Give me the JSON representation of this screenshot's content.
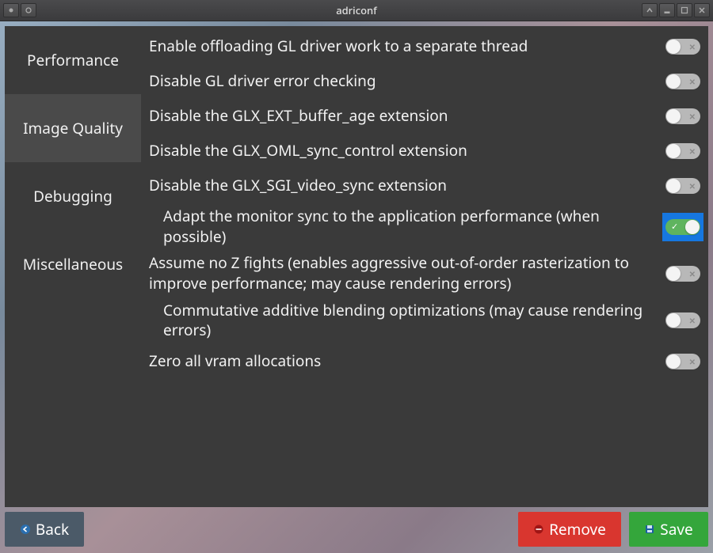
{
  "window": {
    "title": "adriconf"
  },
  "sidebar": {
    "items": [
      {
        "label": "Performance",
        "selected": false
      },
      {
        "label": "Image Quality",
        "selected": true
      },
      {
        "label": "Debugging",
        "selected": false
      },
      {
        "label": "Miscellaneous",
        "selected": false
      }
    ]
  },
  "options": [
    {
      "label": "Enable offloading GL driver work to a separate thread",
      "on": false,
      "indent": false,
      "highlight": false
    },
    {
      "label": "Disable GL driver error checking",
      "on": false,
      "indent": false,
      "highlight": false
    },
    {
      "label": "Disable the GLX_EXT_buffer_age extension",
      "on": false,
      "indent": false,
      "highlight": false
    },
    {
      "label": "Disable the GLX_OML_sync_control extension",
      "on": false,
      "indent": false,
      "highlight": false
    },
    {
      "label": "Disable the GLX_SGI_video_sync extension",
      "on": false,
      "indent": false,
      "highlight": false
    },
    {
      "label": "Adapt the monitor sync to the application performance (when possible)",
      "on": true,
      "indent": true,
      "highlight": true
    },
    {
      "label": "Assume no Z fights (enables aggressive out-of-order rasterization to improve performance; may cause rendering errors)",
      "on": false,
      "indent": false,
      "highlight": false
    },
    {
      "label": "Commutative additive blending optimizations (may cause rendering errors)",
      "on": false,
      "indent": true,
      "highlight": false
    },
    {
      "label": "Zero all vram allocations",
      "on": false,
      "indent": false,
      "highlight": false
    }
  ],
  "footer": {
    "back_label": "Back",
    "remove_label": "Remove",
    "save_label": "Save"
  },
  "icons": {
    "back": "back-arrow-icon",
    "remove": "minus-disc-icon",
    "save": "floppy-icon"
  }
}
